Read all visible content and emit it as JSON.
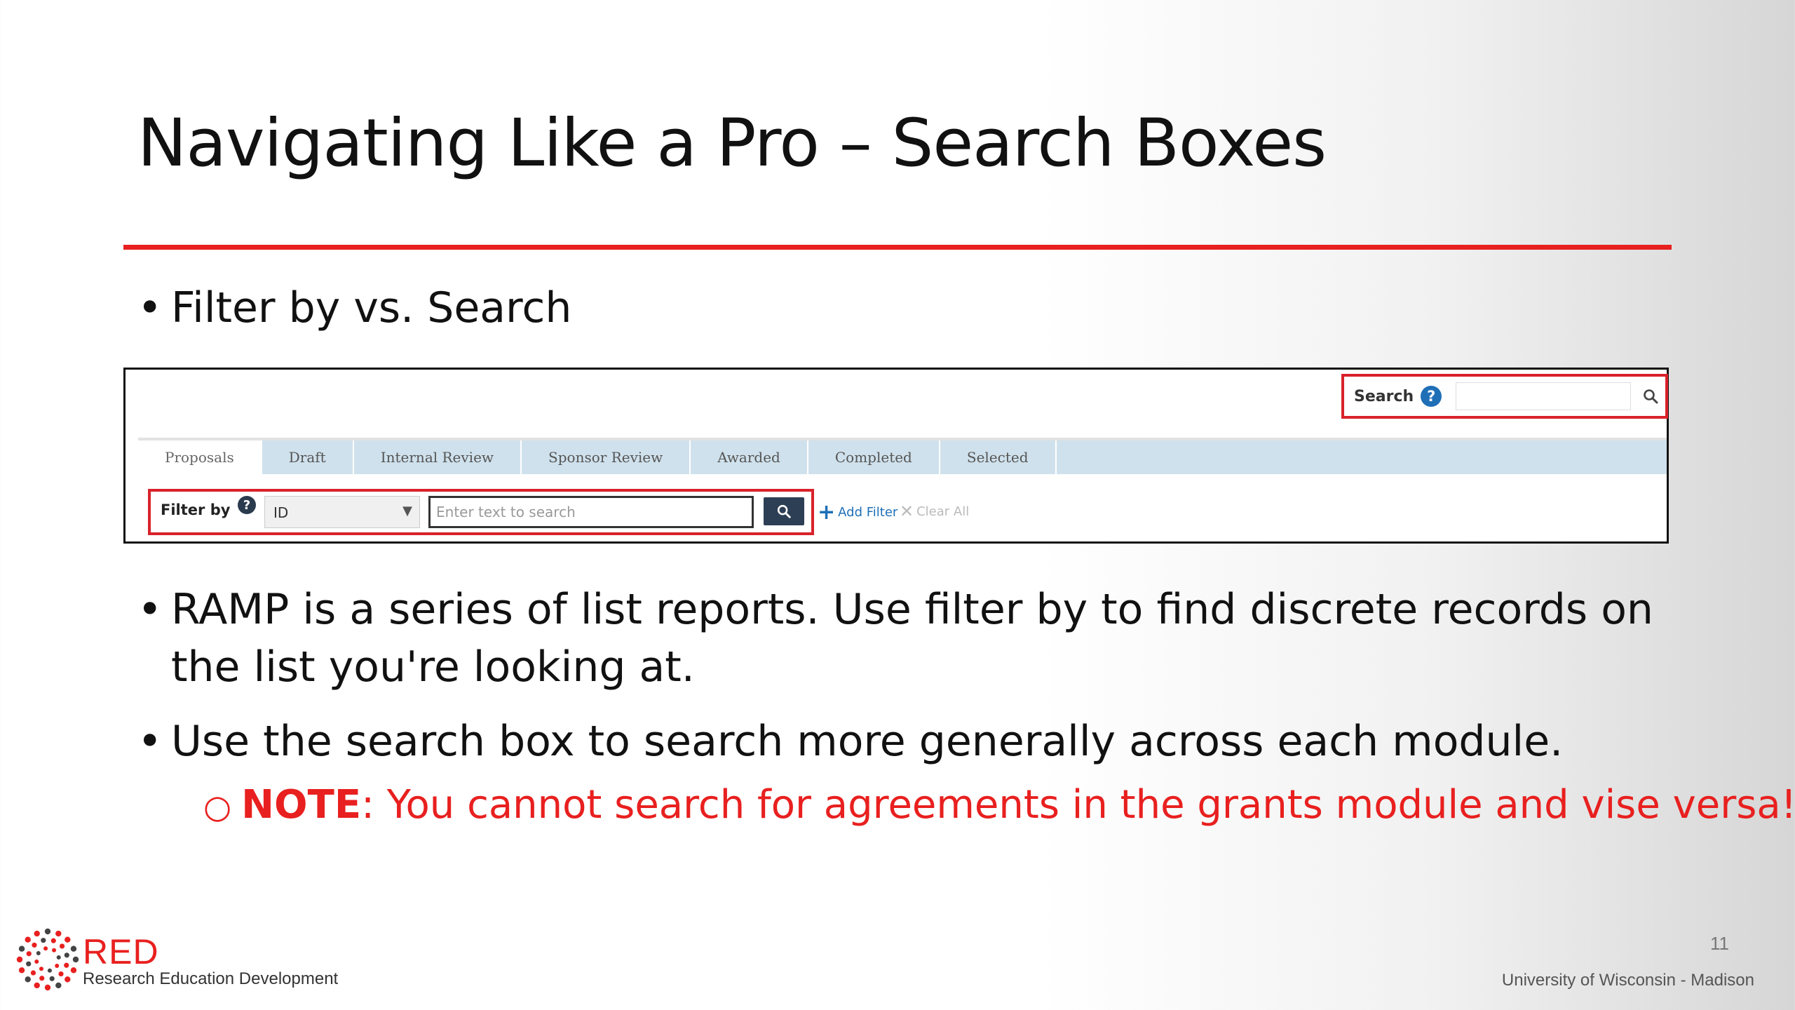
{
  "slide": {
    "title": "Navigating Like a Pro – Search Boxes",
    "bullets": [
      "Filter by vs. Search",
      "RAMP is a series of list reports. Use filter by to find discrete records on the list you're looking at.",
      "Use the search box to search more generally across each module."
    ],
    "note_label": "NOTE",
    "note_text": ": You cannot search for agreements in the grants module and vise versa!",
    "accent_color": "#e8201f"
  },
  "screenshot": {
    "global_search_label": "Search",
    "help_glyph": "?",
    "tabs": [
      {
        "label": "Proposals",
        "active": true
      },
      {
        "label": "Draft",
        "active": false
      },
      {
        "label": "Internal Review",
        "active": false
      },
      {
        "label": "Sponsor Review",
        "active": false
      },
      {
        "label": "Awarded",
        "active": false
      },
      {
        "label": "Completed",
        "active": false
      },
      {
        "label": "Selected",
        "active": false
      }
    ],
    "filter_label": "Filter by",
    "filter_select_value": "ID",
    "filter_placeholder": "Enter text to search",
    "add_filter": "Add Filter",
    "clear_all": "Clear All",
    "highlight_color": "#d9222a"
  },
  "footer": {
    "logo_text": "RED",
    "logo_subtitle": "Research Education Development",
    "page_number": "11",
    "institution": "University of Wisconsin - Madison"
  },
  "icons": [
    "search-icon",
    "help-icon",
    "chevron-down-icon",
    "plus-icon",
    "close-icon",
    "red-logo-icon"
  ]
}
